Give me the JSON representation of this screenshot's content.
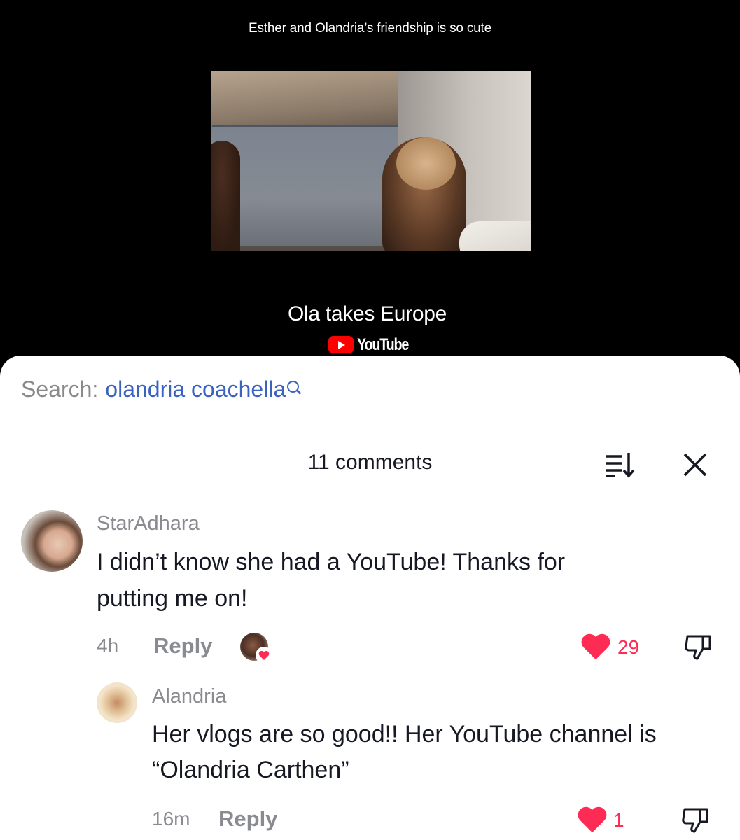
{
  "video": {
    "caption": "Esther and Olandria’s friendship is so cute",
    "title": "Ola takes Europe",
    "platform_label": "YouTube"
  },
  "search": {
    "prefix": "Search:",
    "term": "olandria coachella"
  },
  "comments_header": {
    "count_label": "11 comments"
  },
  "comments": [
    {
      "username": "StarAdhara",
      "text_line1": "I didn’t know she had a YouTube! Thanks for",
      "text_line2": "putting me on!",
      "time": "4h",
      "reply_label": "Reply",
      "likes": "29"
    },
    {
      "username": "Alandria",
      "text_line1": "Her vlogs are so good!! Her YouTube channel is",
      "text_line2": "“Olandria Carthen”",
      "time": "16m",
      "reply_label": "Reply",
      "likes": "1"
    }
  ],
  "colors": {
    "like": "#fe2c55",
    "search_term": "#3a63c0",
    "muted": "#8a8b91"
  }
}
